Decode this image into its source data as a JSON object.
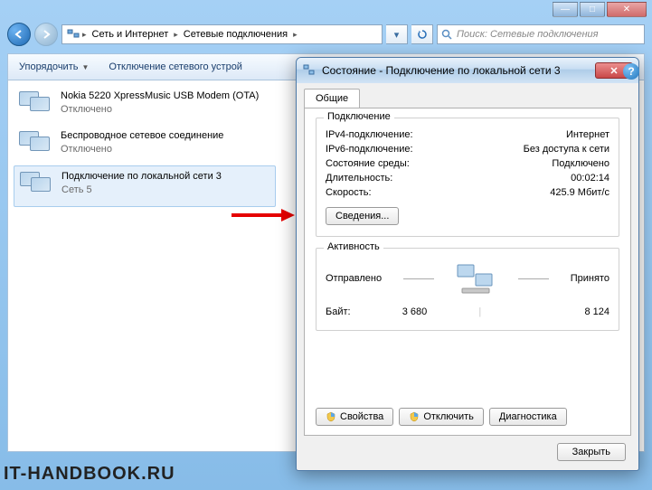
{
  "window": {
    "breadcrumb": {
      "seg1": "Сеть и Интернет",
      "seg2": "Сетевые подключения"
    },
    "search_placeholder": "Поиск: Сетевые подключения"
  },
  "toolbar": {
    "organize": "Упорядочить",
    "disable_device": "Отключение сетевого устрой"
  },
  "connections": [
    {
      "name": "Nokia 5220 XpressMusic USB Modem (OTA)",
      "sub": "Отключено"
    },
    {
      "name": "Беспроводное сетевое соединение",
      "sub": "Отключено"
    },
    {
      "name": "Подключение по локальной сети 3",
      "sub": "Сеть 5"
    }
  ],
  "dialog": {
    "title": "Состояние - Подключение по локальной сети 3",
    "tab_general": "Общие",
    "group_conn": "Подключение",
    "ipv4_label": "IPv4-подключение:",
    "ipv4_value": "Интернет",
    "ipv6_label": "IPv6-подключение:",
    "ipv6_value": "Без доступа к сети",
    "media_label": "Состояние среды:",
    "media_value": "Подключено",
    "duration_label": "Длительность:",
    "duration_value": "00:02:14",
    "speed_label": "Скорость:",
    "speed_value": "425.9 Мбит/с",
    "details_btn": "Сведения...",
    "group_activity": "Активность",
    "sent_label": "Отправлено",
    "recv_label": "Принято",
    "bytes_label": "Байт:",
    "sent_bytes": "3 680",
    "recv_bytes": "8 124",
    "properties_btn": "Свойства",
    "disable_btn": "Отключить",
    "diagnose_btn": "Диагностика",
    "close_btn": "Закрыть"
  },
  "watermark": "IT-HANDBOOK.RU"
}
